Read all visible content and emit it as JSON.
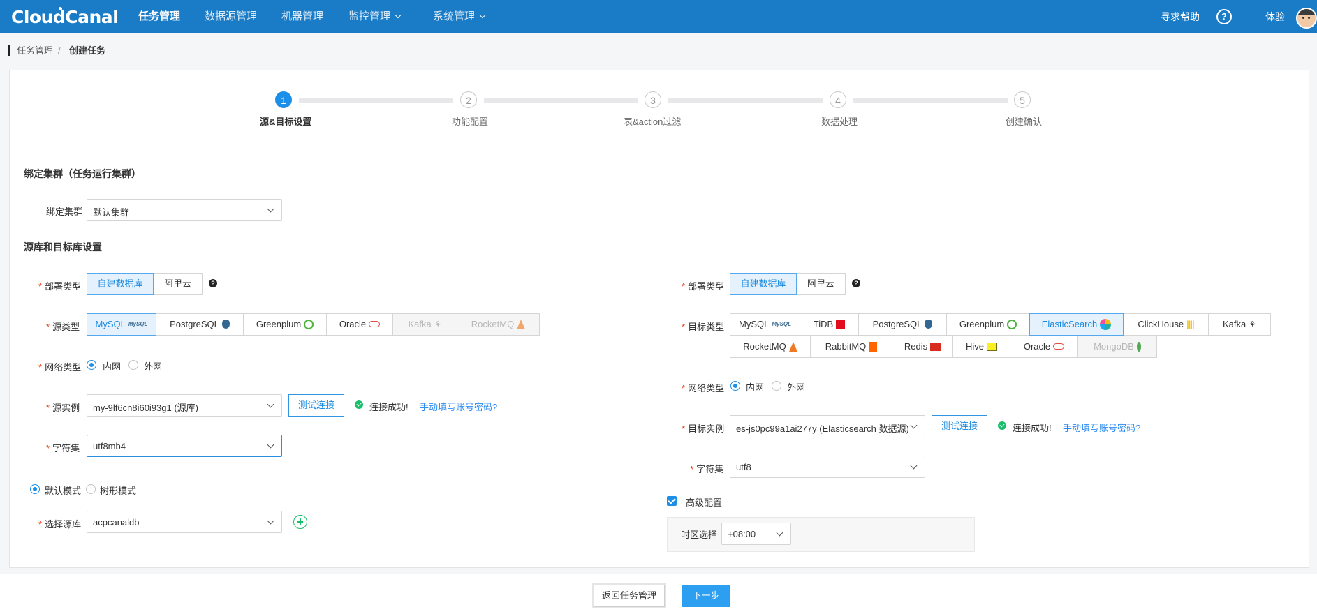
{
  "header": {
    "logo": "CloudCanal",
    "nav": [
      {
        "label": "任务管理",
        "active": true,
        "dropdown": false
      },
      {
        "label": "数据源管理",
        "active": false,
        "dropdown": false
      },
      {
        "label": "机器管理",
        "active": false,
        "dropdown": false
      },
      {
        "label": "监控管理",
        "active": false,
        "dropdown": true
      },
      {
        "label": "系统管理",
        "active": false,
        "dropdown": true
      }
    ],
    "help": "寻求帮助",
    "help_icon": "?",
    "user": "体验"
  },
  "breadcrumb": [
    "任务管理",
    "/",
    "创建任务"
  ],
  "steps": [
    {
      "num": "1",
      "label": "源&目标设置",
      "active": true
    },
    {
      "num": "2",
      "label": "功能配置",
      "active": false
    },
    {
      "num": "3",
      "label": "表&action过滤",
      "active": false
    },
    {
      "num": "4",
      "label": "数据处理",
      "active": false
    },
    {
      "num": "5",
      "label": "创建确认",
      "active": false
    }
  ],
  "cluster": {
    "section_title": "绑定集群（任务运行集群）",
    "label": "绑定集群",
    "value": "默认集群"
  },
  "db_section_title": "源库和目标库设置",
  "required_mark": "*",
  "source": {
    "deploy_label": "部署类型",
    "deploy_options": [
      "自建数据库",
      "阿里云"
    ],
    "deploy_selected": 0,
    "deploy_help": "?",
    "type_label": "源类型",
    "types": [
      {
        "name": "MySQL",
        "icon": "mysql-icon",
        "icon_text": "MySQL",
        "selected": true,
        "disabled": false
      },
      {
        "name": "PostgreSQL",
        "icon": "postgresql-icon",
        "selected": false,
        "disabled": false
      },
      {
        "name": "Greenplum",
        "icon": "greenplum-icon",
        "selected": false,
        "disabled": false
      },
      {
        "name": "Oracle",
        "icon": "oracle-icon",
        "selected": false,
        "disabled": false
      },
      {
        "name": "Kafka",
        "icon": "kafka-icon",
        "icon_text": "⚘",
        "selected": false,
        "disabled": true
      },
      {
        "name": "RocketMQ",
        "icon": "rocketmq-icon",
        "selected": false,
        "disabled": true
      }
    ],
    "network_label": "网络类型",
    "network_options": [
      "内网",
      "外网"
    ],
    "network_selected": 0,
    "instance_label": "源实例",
    "instance_value": "my-9lf6cn8i60i93g1 (源库)",
    "test_button": "测试连接",
    "conn_status": "连接成功!",
    "manual_link": "手动填写账号密码?",
    "charset_label": "字符集",
    "charset_value": "utf8mb4",
    "mode_options": [
      "默认模式",
      "树形模式"
    ],
    "mode_selected": 0,
    "db_label": "选择源库",
    "db_value": "acpcanaldb"
  },
  "target": {
    "deploy_label": "部署类型",
    "deploy_options": [
      "自建数据库",
      "阿里云"
    ],
    "deploy_selected": 0,
    "deploy_help": "?",
    "type_label": "目标类型",
    "types": [
      {
        "name": "MySQL",
        "icon": "mysql-icon",
        "icon_text": "MySQL",
        "selected": false,
        "disabled": false
      },
      {
        "name": "TiDB",
        "icon": "tidb-icon",
        "selected": false,
        "disabled": false
      },
      {
        "name": "PostgreSQL",
        "icon": "postgresql-icon",
        "selected": false,
        "disabled": false
      },
      {
        "name": "Greenplum",
        "icon": "greenplum-icon",
        "selected": false,
        "disabled": false
      },
      {
        "name": "ElasticSearch",
        "icon": "elasticsearch-icon",
        "selected": true,
        "disabled": false
      },
      {
        "name": "ClickHouse",
        "icon": "clickhouse-icon",
        "icon_text": "||||",
        "selected": false,
        "disabled": false
      },
      {
        "name": "Kafka",
        "icon": "kafka-icon",
        "icon_text": "⚘",
        "selected": false,
        "disabled": false
      },
      {
        "name": "RocketMQ",
        "icon": "rocketmq-icon",
        "selected": false,
        "disabled": false
      },
      {
        "name": "RabbitMQ",
        "icon": "rabbitmq-icon",
        "selected": false,
        "disabled": false
      },
      {
        "name": "Redis",
        "icon": "redis-icon",
        "selected": false,
        "disabled": false
      },
      {
        "name": "Hive",
        "icon": "hive-icon",
        "selected": false,
        "disabled": false
      },
      {
        "name": "Oracle",
        "icon": "oracle-icon",
        "selected": false,
        "disabled": false
      },
      {
        "name": "MongoDB",
        "icon": "mongodb-icon",
        "selected": false,
        "disabled": true
      }
    ],
    "network_label": "网络类型",
    "network_options": [
      "内网",
      "外网"
    ],
    "network_selected": 0,
    "instance_label": "目标实例",
    "instance_value": "es-js0pc99a1ai277y (Elasticsearch 数据源)",
    "test_button": "测试连接",
    "conn_status": "连接成功!",
    "manual_link": "手动填写账号密码?",
    "charset_label": "字符集",
    "charset_value": "utf8",
    "advanced_label": "高级配置",
    "advanced_checked": true,
    "timezone_label": "时区选择",
    "timezone_value": "+08:00"
  },
  "footer": {
    "back_button": "返回任务管理",
    "next_button": "下一步"
  },
  "colors": {
    "header_bg": "#1a7cc7",
    "primary": "#1c90e8",
    "selected_bg": "#e5f2fd",
    "success": "#19be6b",
    "link": "#2d8cf0",
    "required": "#ed3f14"
  }
}
